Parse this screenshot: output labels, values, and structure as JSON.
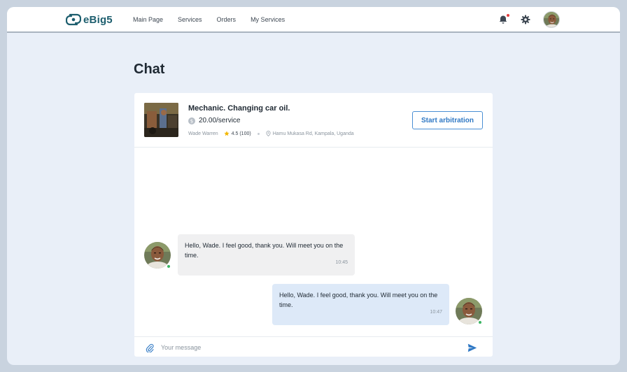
{
  "header": {
    "logo_text": "eBig5",
    "nav": [
      {
        "label": "Main Page"
      },
      {
        "label": "Services"
      },
      {
        "label": "Orders"
      },
      {
        "label": "My Services"
      }
    ],
    "icons": [
      "bell-icon",
      "gear-icon"
    ],
    "notification_dot_color": "#e53e3e"
  },
  "page": {
    "title": "Chat"
  },
  "listing": {
    "title": "Mechanic. Changing car oil.",
    "price": "20.00/service",
    "seller": "Wade Warren",
    "rating": "4.5 (100)",
    "location": "Hamu Mukasa Rd, Kampala, Uganda",
    "arbitration_button": "Start arbitration"
  },
  "messages": [
    {
      "direction": "incoming",
      "text": "Hello, Wade. I feel good, thank you. Will meet you on the time.",
      "time": "10:45"
    },
    {
      "direction": "outgoing",
      "text": "Hello, Wade. I feel good, thank you. Will meet you on the time.",
      "time": "10:47"
    }
  ],
  "composer": {
    "placeholder": "Your message",
    "value": ""
  },
  "colors": {
    "accent": "#2f78c4",
    "brand": "#1d5e6e",
    "online": "#3cb563",
    "outgoing_bubble": "#dde9f8",
    "incoming_bubble": "#f0f0f1"
  }
}
